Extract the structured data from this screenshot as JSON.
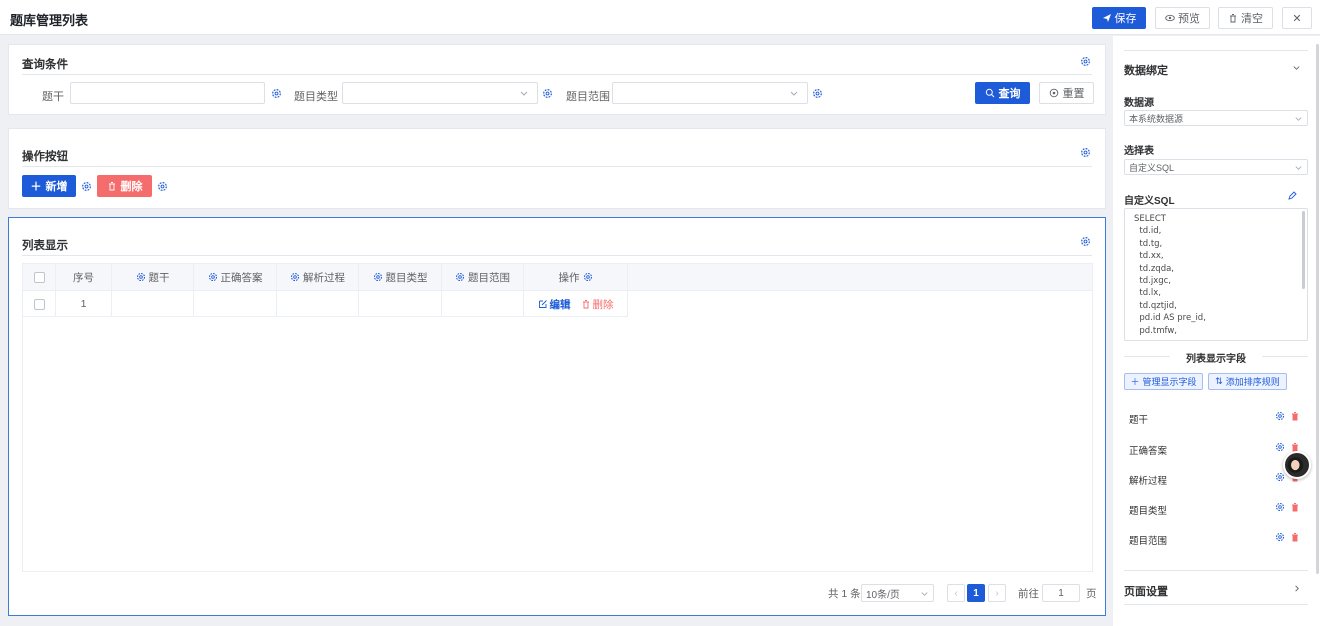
{
  "app": {
    "title": "题库管理列表"
  },
  "toolbar": {
    "save": "保存",
    "preview": "预览",
    "clear": "清空",
    "close": "✕"
  },
  "query": {
    "title": "查询条件",
    "fields": [
      {
        "label": "题干",
        "value": ""
      },
      {
        "label": "题目类型",
        "value": ""
      },
      {
        "label": "题目范围",
        "value": ""
      }
    ],
    "search_btn": "查询",
    "reset_btn": "重置"
  },
  "actions": {
    "title": "操作按钮",
    "add_btn": "新增",
    "delete_btn": "删除"
  },
  "list": {
    "title": "列表显示",
    "columns": [
      "序号",
      "题干",
      "正确答案",
      "解析过程",
      "题目类型",
      "题目范围",
      "操作"
    ],
    "rows": [
      {
        "index": "1",
        "tg": "",
        "zqda": "",
        "jxgc": "",
        "lx": "",
        "fw": "",
        "edit": "编辑",
        "delete": "删除"
      }
    ],
    "pager": {
      "total": "共 1 条",
      "page_size": "10条/页",
      "current": "1",
      "goto_label": "前往",
      "goto_value": "1",
      "page_unit": "页"
    }
  },
  "panel": {
    "binding_title": "数据绑定",
    "source_label": "数据源",
    "source_value": "本系统数据源",
    "table_label": "选择表",
    "table_value": "自定义SQL",
    "sql_label": "自定义SQL",
    "sql_lines": [
      "SELECT",
      "  td.id,",
      "  td.tg,",
      "  td.xx,",
      "  td.zqda,",
      "  td.jxgc,",
      "  td.lx,",
      "  td.qztjid,",
      "  pd.id AS pre_id,",
      "  pd.tmfw,"
    ],
    "fields_title": "列表显示字段",
    "manage_btn": "管理显示字段",
    "sort_btn": "添加排序规则",
    "fields": [
      "题干",
      "正确答案",
      "解析过程",
      "题目类型",
      "题目范围"
    ],
    "page_settings": "页面设置"
  },
  "colors": {
    "accent": "#1e5bd8",
    "danger": "#f56c6c",
    "active_border": "#3d7bd9"
  }
}
